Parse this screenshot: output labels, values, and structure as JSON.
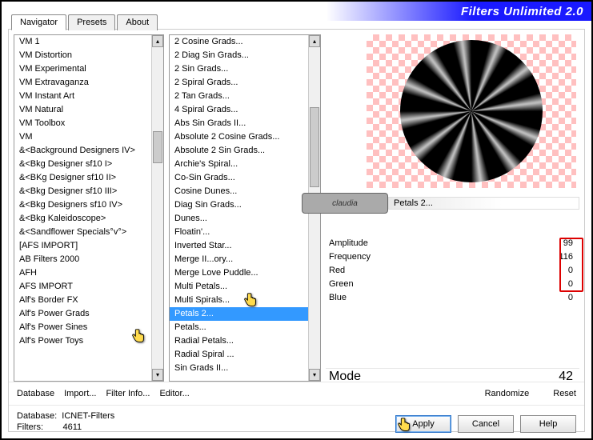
{
  "app_title": "Filters Unlimited 2.0",
  "tabs": [
    "Navigator",
    "Presets",
    "About"
  ],
  "active_tab": 0,
  "left_list": [
    "VM 1",
    "VM Distortion",
    "VM Experimental",
    "VM Extravaganza",
    "VM Instant Art",
    "VM Natural",
    "VM Toolbox",
    "VM",
    "&<Background Designers IV>",
    "&<Bkg Designer sf10 I>",
    "&<BKg Designer sf10 II>",
    "&<Bkg Designer sf10 III>",
    "&<Bkg Designers sf10 IV>",
    "&<Bkg Kaleidoscope>",
    "&<Sandflower Specials°v°>",
    "[AFS IMPORT]",
    "AB Filters 2000",
    "AFH",
    "AFS IMPORT",
    "Alf's Border FX",
    "Alf's Power Grads",
    "Alf's Power Sines",
    "Alf's Power Toys"
  ],
  "left_selected_index": null,
  "mid_list": [
    "2 Cosine Grads...",
    "2 Diag Sin Grads...",
    "2 Sin Grads...",
    "2 Spiral Grads...",
    "2 Tan Grads...",
    "4 Spiral Grads...",
    "Abs Sin Grads II...",
    "Absolute 2 Cosine Grads...",
    "Absolute 2 Sin Grads...",
    "Archie's Spiral...",
    "Co-Sin Grads...",
    "Cosine Dunes...",
    "Diag Sin Grads...",
    "Dunes...",
    "Floatin'...",
    "Inverted Star...",
    "Merge II...ory...",
    "Merge Love Puddle...",
    "Multi Petals...",
    "Multi Spirals...",
    "Petals 2...",
    "Petals...",
    "Radial Petals...",
    "Radial Spiral ...",
    "Sin Grads II..."
  ],
  "mid_selected_index": 20,
  "preview_title": "Petals 2...",
  "claudia_label": "claudia",
  "params": [
    {
      "label": "Amplitude",
      "value": 99,
      "highlight": false
    },
    {
      "label": "Frequency",
      "value": 116,
      "highlight": true
    },
    {
      "label": "Red",
      "value": 0,
      "highlight": true
    },
    {
      "label": "Green",
      "value": 0,
      "highlight": true
    },
    {
      "label": "Blue",
      "value": 0,
      "highlight": true
    }
  ],
  "mode_label": "Mode",
  "mode_value": 42,
  "link_buttons": {
    "database": "Database",
    "import": "Import...",
    "filter_info": "Filter Info...",
    "editor": "Editor...",
    "randomize": "Randomize",
    "reset": "Reset"
  },
  "status": {
    "db_label": "Database:",
    "db_value": "ICNET-Filters",
    "filters_label": "Filters:",
    "filters_value": "4611"
  },
  "std_buttons": {
    "apply": "Apply",
    "cancel": "Cancel",
    "help": "Help"
  }
}
